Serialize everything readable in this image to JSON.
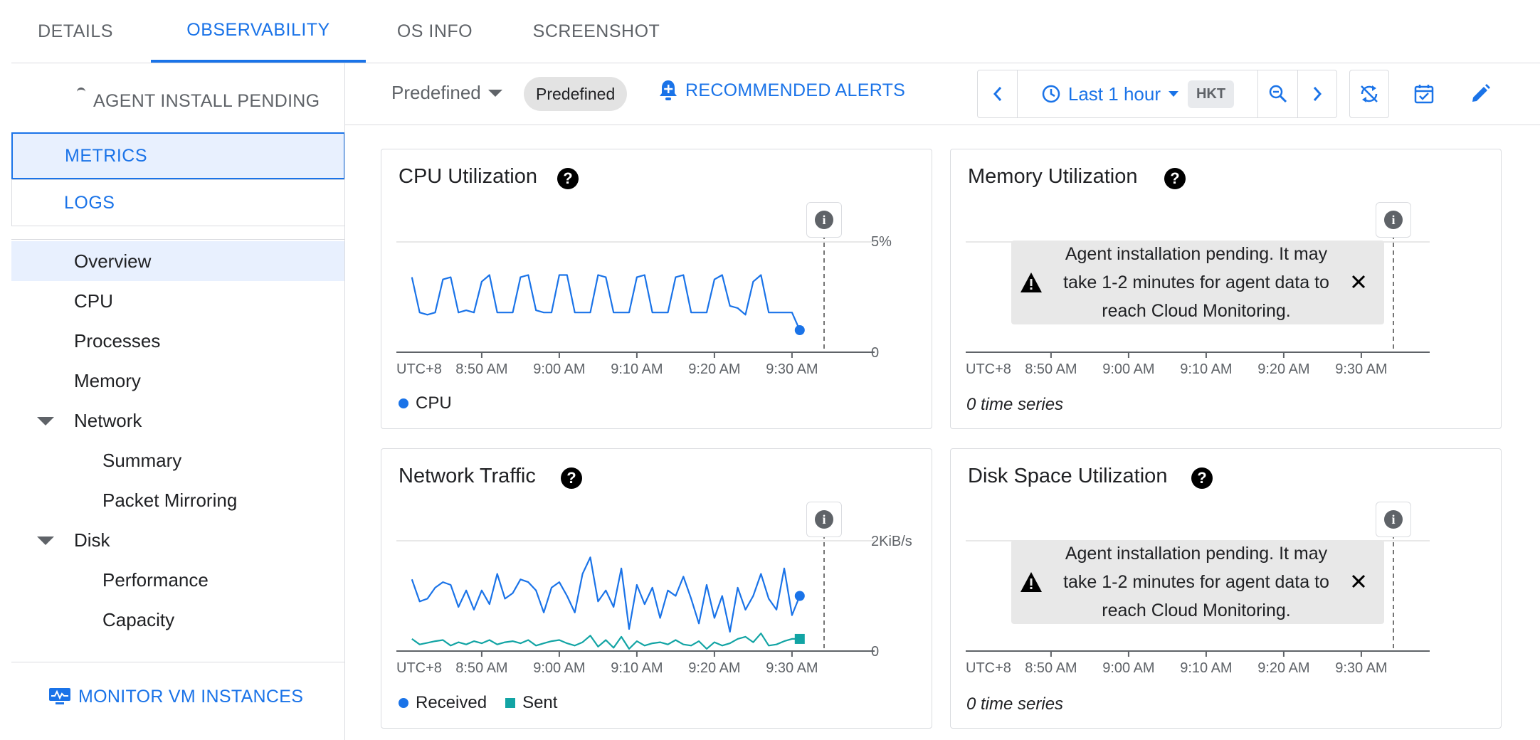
{
  "tabs": [
    {
      "label": "DETAILS",
      "active": false
    },
    {
      "label": "OBSERVABILITY",
      "active": true
    },
    {
      "label": "OS INFO",
      "active": false
    },
    {
      "label": "SCREENSHOT",
      "active": false
    }
  ],
  "sidebar": {
    "agent_status": "AGENT INSTALL PENDING",
    "segments": [
      {
        "label": "METRICS",
        "selected": true
      },
      {
        "label": "LOGS",
        "selected": false
      }
    ],
    "nav": [
      {
        "label": "Overview",
        "active": true
      },
      {
        "label": "CPU"
      },
      {
        "label": "Processes"
      },
      {
        "label": "Memory"
      },
      {
        "label": "Network",
        "expanded": true
      },
      {
        "label": "Summary"
      },
      {
        "label": "Packet Mirroring"
      },
      {
        "label": "Disk",
        "expanded": true
      },
      {
        "label": "Performance"
      },
      {
        "label": "Capacity"
      }
    ],
    "monitor_link": "MONITOR VM INSTANCES"
  },
  "toolbar": {
    "dashboard_dropdown": "Predefined",
    "dashboard_chip": "Predefined",
    "recommended_alerts": "RECOMMENDED ALERTS",
    "time_range": "Last 1 hour",
    "timezone": "HKT"
  },
  "charts": {
    "x_ticks": [
      "UTC+8",
      "8:50 AM",
      "9:00 AM",
      "9:10 AM",
      "9:20 AM",
      "9:30 AM"
    ],
    "cpu": {
      "title": "CPU Utilization",
      "y_max_label": "5%",
      "y_min_label": "0",
      "legend": "CPU",
      "color": "#1a73e8"
    },
    "memory": {
      "title": "Memory Utilization",
      "banner": "Agent installation pending. It may take 1-2 minutes for agent data to reach Cloud Monitoring.",
      "ts_count": "0 time series"
    },
    "network": {
      "title": "Network Traffic",
      "y_max_label": "2KiB/s",
      "y_min_label": "0",
      "legend_received": "Received",
      "legend_sent": "Sent",
      "color_received": "#1a73e8",
      "color_sent": "#12a4a4"
    },
    "disk": {
      "title": "Disk Space Utilization",
      "banner": "Agent installation pending. It may take 1-2 minutes for agent data to reach Cloud Monitoring.",
      "ts_count": "0 time series"
    }
  },
  "chart_data": [
    {
      "type": "line",
      "title": "CPU Utilization",
      "ylabel": "",
      "ylim": [
        0,
        5
      ],
      "y_unit": "%",
      "x_range": [
        "8:41 AM",
        "9:31 AM"
      ],
      "series": [
        {
          "name": "CPU",
          "x": [
            "8:41",
            "8:42",
            "8:43",
            "8:44",
            "8:45",
            "8:46",
            "8:47",
            "8:48",
            "8:49",
            "8:50",
            "8:51",
            "8:52",
            "8:53",
            "8:54",
            "8:55",
            "8:56",
            "8:57",
            "8:58",
            "8:59",
            "9:00",
            "9:01",
            "9:02",
            "9:03",
            "9:04",
            "9:05",
            "9:06",
            "9:07",
            "9:08",
            "9:09",
            "9:10",
            "9:11",
            "9:12",
            "9:13",
            "9:14",
            "9:15",
            "9:16",
            "9:17",
            "9:18",
            "9:19",
            "9:20",
            "9:21",
            "9:22",
            "9:23",
            "9:24",
            "9:25",
            "9:26",
            "9:27",
            "9:28",
            "9:29",
            "9:30",
            "9:31"
          ],
          "values": [
            3.4,
            1.8,
            1.7,
            1.8,
            3.3,
            3.4,
            1.8,
            1.9,
            1.8,
            3.2,
            3.5,
            1.8,
            1.8,
            1.8,
            3.4,
            3.5,
            1.9,
            1.8,
            1.8,
            3.5,
            3.5,
            1.8,
            1.8,
            1.8,
            3.5,
            3.4,
            1.8,
            1.8,
            1.8,
            3.4,
            3.5,
            1.8,
            1.8,
            1.8,
            3.4,
            3.5,
            1.8,
            1.8,
            1.8,
            3.3,
            3.5,
            2.1,
            2.0,
            1.7,
            3.2,
            3.5,
            1.8,
            1.8,
            1.8,
            1.8,
            1.0
          ]
        }
      ]
    },
    {
      "type": "line",
      "title": "Network Traffic",
      "ylabel": "",
      "ylim": [
        0,
        2
      ],
      "y_unit": "KiB/s",
      "x_range": [
        "8:41 AM",
        "9:31 AM"
      ],
      "series": [
        {
          "name": "Received",
          "x": [
            "8:41",
            "8:42",
            "8:43",
            "8:44",
            "8:45",
            "8:46",
            "8:47",
            "8:48",
            "8:49",
            "8:50",
            "8:51",
            "8:52",
            "8:53",
            "8:54",
            "8:55",
            "8:56",
            "8:57",
            "8:58",
            "8:59",
            "9:00",
            "9:01",
            "9:02",
            "9:03",
            "9:04",
            "9:05",
            "9:06",
            "9:07",
            "9:08",
            "9:09",
            "9:10",
            "9:11",
            "9:12",
            "9:13",
            "9:14",
            "9:15",
            "9:16",
            "9:17",
            "9:18",
            "9:19",
            "9:20",
            "9:21",
            "9:22",
            "9:23",
            "9:24",
            "9:25",
            "9:26",
            "9:27",
            "9:28",
            "9:29",
            "9:30",
            "9:31"
          ],
          "values": [
            1.3,
            0.9,
            0.95,
            1.15,
            1.25,
            1.2,
            0.8,
            1.1,
            0.75,
            1.1,
            0.85,
            1.4,
            0.95,
            1.05,
            1.3,
            1.25,
            1.1,
            0.7,
            1.15,
            1.25,
            1.0,
            0.7,
            1.4,
            1.7,
            0.9,
            1.1,
            0.8,
            1.5,
            0.4,
            1.2,
            0.85,
            1.15,
            0.6,
            1.1,
            1.0,
            1.35,
            0.95,
            0.5,
            1.2,
            0.6,
            1.0,
            0.35,
            1.15,
            0.75,
            1.0,
            1.4,
            0.95,
            0.75,
            1.5,
            0.65,
            1.0
          ]
        },
        {
          "name": "Sent",
          "x": [
            "8:41",
            "8:42",
            "8:43",
            "8:44",
            "8:45",
            "8:46",
            "8:47",
            "8:48",
            "8:49",
            "8:50",
            "8:51",
            "8:52",
            "8:53",
            "8:54",
            "8:55",
            "8:56",
            "8:57",
            "8:58",
            "8:59",
            "9:00",
            "9:01",
            "9:02",
            "9:03",
            "9:04",
            "9:05",
            "9:06",
            "9:07",
            "9:08",
            "9:09",
            "9:10",
            "9:11",
            "9:12",
            "9:13",
            "9:14",
            "9:15",
            "9:16",
            "9:17",
            "9:18",
            "9:19",
            "9:20",
            "9:21",
            "9:22",
            "9:23",
            "9:24",
            "9:25",
            "9:26",
            "9:27",
            "9:28",
            "9:29",
            "9:30",
            "9:31"
          ],
          "values": [
            0.22,
            0.12,
            0.15,
            0.18,
            0.2,
            0.1,
            0.16,
            0.12,
            0.18,
            0.14,
            0.2,
            0.12,
            0.16,
            0.18,
            0.14,
            0.2,
            0.1,
            0.14,
            0.18,
            0.2,
            0.14,
            0.1,
            0.16,
            0.28,
            0.08,
            0.2,
            0.06,
            0.26,
            0.04,
            0.18,
            0.1,
            0.14,
            0.16,
            0.12,
            0.2,
            0.12,
            0.1,
            0.18,
            0.04,
            0.16,
            0.1,
            0.14,
            0.22,
            0.26,
            0.16,
            0.32,
            0.1,
            0.12,
            0.18,
            0.22,
            0.22
          ]
        }
      ]
    }
  ]
}
